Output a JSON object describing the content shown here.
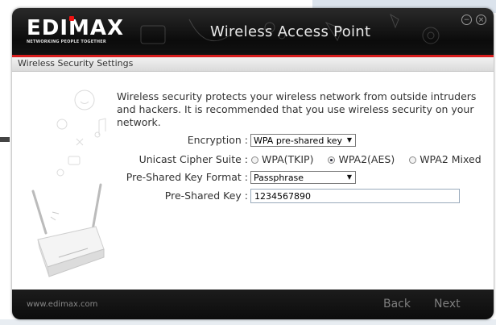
{
  "window": {
    "logo_text": "EDIMAX",
    "logo_tagline": "NETWORKING PEOPLE TOGETHER",
    "title": "Wireless Access Point"
  },
  "breadcrumb": {
    "label": "Wireless Security Settings"
  },
  "main": {
    "description": "Wireless security protects your wireless network from outside intruders and hackers. It is recommended that you use wireless security on your network.",
    "encryption": {
      "label": "Encryption :",
      "value": "WPA pre-shared key"
    },
    "cipher": {
      "label": "Unicast Cipher Suite :",
      "options": [
        "WPA(TKIP)",
        "WPA2(AES)",
        "WPA2 Mixed"
      ],
      "selected": "WPA2(AES)"
    },
    "key_format": {
      "label": "Pre-Shared Key Format :",
      "value": "Passphrase"
    },
    "key": {
      "label": "Pre-Shared Key :",
      "value": "1234567890"
    }
  },
  "footer": {
    "url": "www.edimax.com",
    "back_label": "Back",
    "next_label": "Next"
  },
  "colors": {
    "accent": "#d81e1e",
    "titlebar": "#121212"
  }
}
